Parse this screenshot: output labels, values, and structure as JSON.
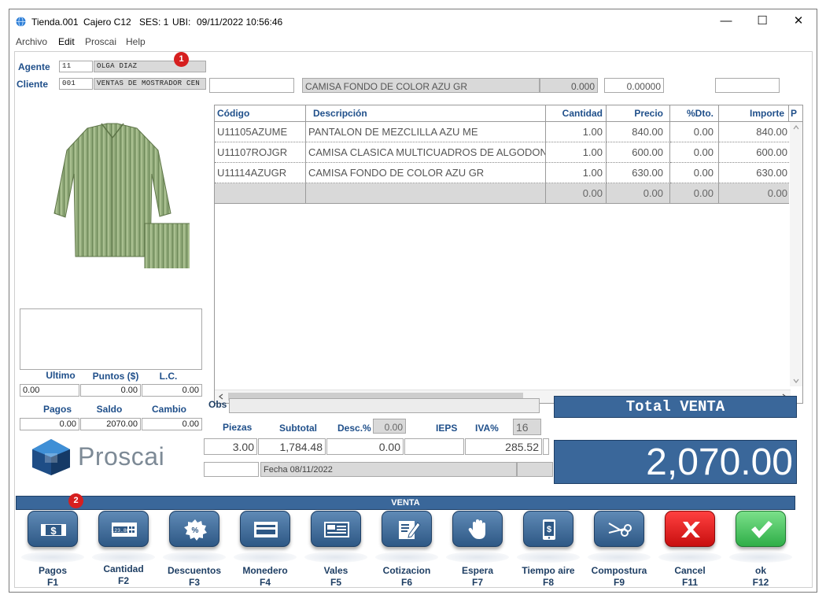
{
  "window": {
    "store": "Tienda.001",
    "cashier": "Cajero C12",
    "session": "SES: 1",
    "ubi": "UBI:",
    "datetime": "09/11/2022 10:56:46",
    "minimize": "—",
    "maximize": "☐",
    "close": "✕"
  },
  "menu": {
    "archivo": "Archivo",
    "edit": "Edit",
    "proscai": "Proscai",
    "help": "Help"
  },
  "agent": {
    "label": "Agente",
    "code": "11",
    "name": "OLGA DIAZ",
    "badge": "1"
  },
  "client": {
    "label": "Cliente",
    "code": "001",
    "name": "VENTAS DE MOSTRADOR CEN"
  },
  "item_entry": {
    "code": "",
    "description": "CAMISA FONDO DE COLOR AZU GR",
    "qty": "0.000",
    "price": "0.00000",
    "extra": ""
  },
  "grid": {
    "headers": {
      "code": "Código",
      "desc": "Descripción",
      "qty": "Cantidad",
      "price": "Precio",
      "disc": "%Dto.",
      "amount": "Importe",
      "more": "P"
    },
    "rows": [
      {
        "code": "U11105AZUME",
        "desc": "PANTALON DE MEZCLILLA AZU ME",
        "qty": "1.00",
        "price": "840.00",
        "disc": "0.00",
        "amount": "840.00"
      },
      {
        "code": "U11107ROJGR",
        "desc": "CAMISA CLASICA MULTICUADROS DE ALGODON RO",
        "qty": "1.00",
        "price": "600.00",
        "disc": "0.00",
        "amount": "600.00"
      },
      {
        "code": "U11114AZUGR",
        "desc": "CAMISA FONDO DE COLOR AZU GR",
        "qty": "1.00",
        "price": "630.00",
        "disc": "0.00",
        "amount": "630.00"
      }
    ],
    "totals_row": {
      "qty": "0.00",
      "price": "0.00",
      "disc": "0.00",
      "amount": "0.00"
    }
  },
  "left_stats": {
    "ultimo_label": "Ultimo",
    "puntos_label": "Puntos ($)",
    "lc_label": "L.C.",
    "ultimo": "0.00",
    "puntos": "0.00",
    "lc": "0.00",
    "pagos_label": "Pagos",
    "saldo_label": "Saldo",
    "cambio_label": "Cambio",
    "pagos": "0.00",
    "saldo": "2070.00",
    "cambio": "0.00"
  },
  "logo": {
    "text": "Proscai"
  },
  "summary": {
    "obs_label": "Obs",
    "obs": "",
    "piezas_label": "Piezas",
    "subtotal_label": "Subtotal",
    "desc_label": "Desc.%",
    "desc_pct": "0.00",
    "ieps_label": "IEPS",
    "iva_label": "IVA%",
    "iva_pct": "16",
    "piezas": "3.00",
    "subtotal": "1,784.48",
    "desc_amount": "0.00",
    "ieps": "",
    "iva_amount": "285.52",
    "small_field": "",
    "fecha": "Fecha 08/11/2022",
    "fecha_extra": ""
  },
  "total": {
    "label": "Total VENTA",
    "value": "2,070.00"
  },
  "mode_bar": "VENTA",
  "function_badge": "2",
  "buttons": [
    {
      "label": "Pagos",
      "key": "F1"
    },
    {
      "label": "Cantidad",
      "key": "F2"
    },
    {
      "label": "Descuentos",
      "key": "F3"
    },
    {
      "label": "Monedero",
      "key": "F4"
    },
    {
      "label": "Vales",
      "key": "F5"
    },
    {
      "label": "Cotizacion",
      "key": "F6"
    },
    {
      "label": "Espera",
      "key": "F7"
    },
    {
      "label": "Tiempo aire",
      "key": "F8"
    },
    {
      "label": "Compostura",
      "key": "F9"
    },
    {
      "label": "Cancel",
      "key": "F11"
    },
    {
      "label": "ok",
      "key": "F12"
    }
  ],
  "icon_text": {
    "cantidad_display": "123.86",
    "dollar": "$",
    "percent": "%"
  },
  "colors": {
    "accent_blue": "#3a679a",
    "label_blue": "#1f4f8a",
    "cancel_red": "#e02020",
    "ok_green": "#3cbf55",
    "badge_red": "#d61f1f"
  }
}
